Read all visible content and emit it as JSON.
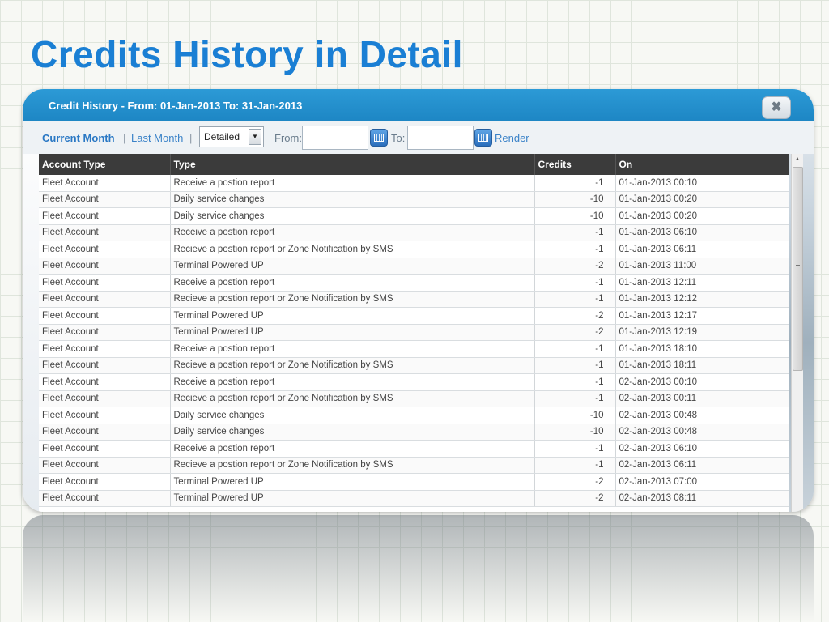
{
  "slide": {
    "title": "Credits History in Detail"
  },
  "window": {
    "title": "Credit History - From: 01-Jan-2013 To: 31-Jan-2013",
    "close_icon": "close-icon"
  },
  "toolbar": {
    "current_month": "Current Month",
    "separator": "|",
    "last_month": "Last Month",
    "view_select": "Detailed",
    "from_label": "From:",
    "from_value": "",
    "to_label": "To:",
    "to_value": "",
    "render_label": "Render"
  },
  "table": {
    "headers": [
      "Account Type",
      "Type",
      "Credits",
      "On"
    ],
    "rows": [
      [
        "Fleet Account",
        "Receive a postion report",
        "-1",
        "01-Jan-2013 00:10"
      ],
      [
        "Fleet Account",
        "Daily service changes",
        "-10",
        "01-Jan-2013 00:20"
      ],
      [
        "Fleet Account",
        "Daily service changes",
        "-10",
        "01-Jan-2013 00:20"
      ],
      [
        "Fleet Account",
        "Receive a postion report",
        "-1",
        "01-Jan-2013 06:10"
      ],
      [
        "Fleet Account",
        "Recieve a postion report or Zone Notification by SMS",
        "-1",
        "01-Jan-2013 06:11"
      ],
      [
        "Fleet Account",
        "Terminal Powered UP",
        "-2",
        "01-Jan-2013 11:00"
      ],
      [
        "Fleet Account",
        "Receive a postion report",
        "-1",
        "01-Jan-2013 12:11"
      ],
      [
        "Fleet Account",
        "Recieve a postion report or Zone Notification by SMS",
        "-1",
        "01-Jan-2013 12:12"
      ],
      [
        "Fleet Account",
        "Terminal Powered UP",
        "-2",
        "01-Jan-2013 12:17"
      ],
      [
        "Fleet Account",
        "Terminal Powered UP",
        "-2",
        "01-Jan-2013 12:19"
      ],
      [
        "Fleet Account",
        "Receive a postion report",
        "-1",
        "01-Jan-2013 18:10"
      ],
      [
        "Fleet Account",
        "Recieve a postion report or Zone Notification by SMS",
        "-1",
        "01-Jan-2013 18:11"
      ],
      [
        "Fleet Account",
        "Receive a postion report",
        "-1",
        "02-Jan-2013 00:10"
      ],
      [
        "Fleet Account",
        "Recieve a postion report or Zone Notification by SMS",
        "-1",
        "02-Jan-2013 00:11"
      ],
      [
        "Fleet Account",
        "Daily service changes",
        "-10",
        "02-Jan-2013 00:48"
      ],
      [
        "Fleet Account",
        "Daily service changes",
        "-10",
        "02-Jan-2013 00:48"
      ],
      [
        "Fleet Account",
        "Receive a postion report",
        "-1",
        "02-Jan-2013 06:10"
      ],
      [
        "Fleet Account",
        "Recieve a postion report or Zone Notification by SMS",
        "-1",
        "02-Jan-2013 06:11"
      ],
      [
        "Fleet Account",
        "Terminal Powered UP",
        "-2",
        "02-Jan-2013 07:00"
      ],
      [
        "Fleet Account",
        "Terminal Powered UP",
        "-2",
        "02-Jan-2013 08:11"
      ]
    ]
  },
  "colors": {
    "title": "#1a7fd4",
    "titlebar": "#1d86c4",
    "header": "#3b3b3b"
  }
}
